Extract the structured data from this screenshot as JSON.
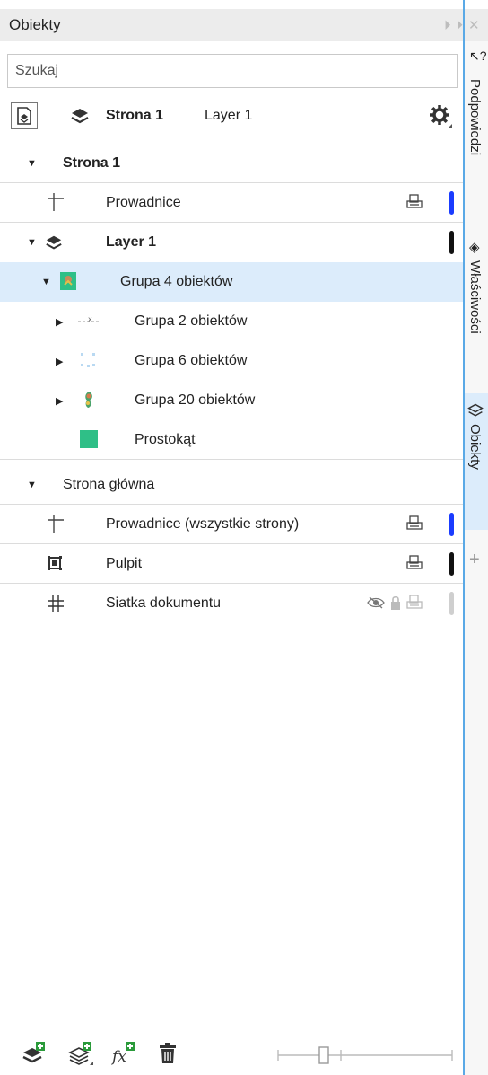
{
  "titlebar": {
    "title": "Obiekty"
  },
  "search": {
    "placeholder": "Szukaj"
  },
  "toolbar": {
    "page": "Strona 1",
    "layer": "Layer 1"
  },
  "tree": {
    "page": {
      "label": "Strona 1"
    },
    "guides": {
      "label": "Prowadnice",
      "bar_color": "#1a3cff"
    },
    "layer": {
      "label": "Layer 1",
      "bar_color": "#111111"
    },
    "group4": {
      "label": "Grupa 4 obiektów"
    },
    "group2": {
      "label": "Grupa 2 obiektów"
    },
    "group6": {
      "label": "Grupa 6 obiektów"
    },
    "group20": {
      "label": "Grupa 20 obiektów"
    },
    "rect": {
      "label": "Prostokąt",
      "color": "#2fbf87"
    },
    "master": {
      "label": "Strona główna"
    },
    "master_guides": {
      "label": "Prowadnice (wszystkie strony)",
      "bar_color": "#1a3cff"
    },
    "desktop": {
      "label": "Pulpit",
      "bar_color": "#111111"
    },
    "grid": {
      "label": "Siatka dokumentu",
      "bar_color": "#cfcfcf"
    }
  },
  "sidetabs": {
    "hints": "Podpowiedzi",
    "properties": "Właściwości",
    "objects": "Obiekty"
  },
  "colors": {
    "accent": "#5aa9e6",
    "selection": "#dcecfb"
  }
}
